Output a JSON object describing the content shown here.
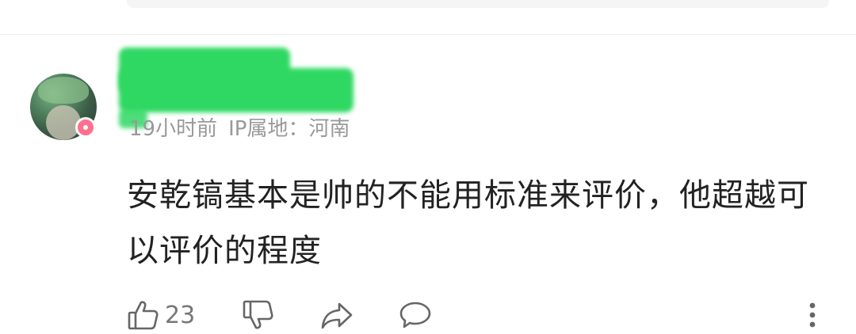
{
  "comment": {
    "time": "19小时前",
    "ip_location": "IP属地：河南",
    "text": "安乾镐基本是帅的不能用标准来评价，他超越可以评价的程度",
    "likes": "23"
  },
  "icons": {
    "like": "thumbs-up-icon",
    "dislike": "thumbs-down-icon",
    "share": "share-icon",
    "reply": "comment-icon",
    "more": "more-vertical-icon"
  },
  "colors": {
    "redaction": "#2fd862",
    "meta_text": "#999999",
    "body_text": "#222222",
    "badge": "#ff6f8e"
  }
}
